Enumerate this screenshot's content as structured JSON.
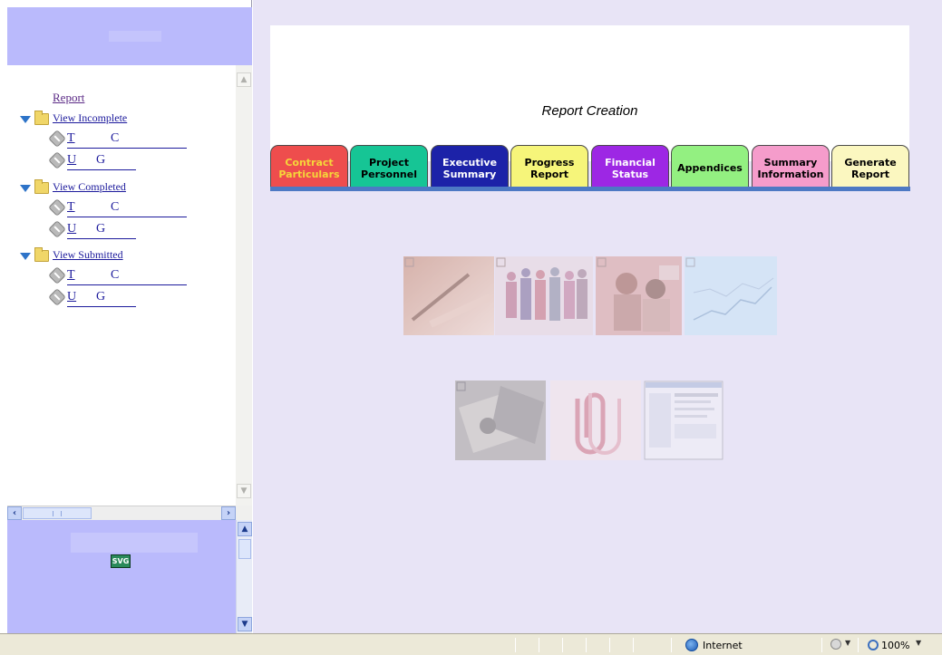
{
  "nav_tree": {
    "report_label": "Report",
    "groups": [
      {
        "label": "View Incomplete",
        "items": [
          {
            "first": "T",
            "second": "C"
          },
          {
            "first": "U",
            "second": "G"
          }
        ]
      },
      {
        "label": "View Completed",
        "items": [
          {
            "first": "T",
            "second": "C"
          },
          {
            "first": "U",
            "second": "G"
          }
        ]
      },
      {
        "label": "View Submitted",
        "items": [
          {
            "first": "T",
            "second": "C"
          },
          {
            "first": "U",
            "second": "G"
          }
        ]
      }
    ]
  },
  "bottom_panel": {
    "badge_text": "SVG"
  },
  "main": {
    "title": "Report Creation",
    "tabs": [
      {
        "label": "Contract\nParticulars",
        "bg": "#ee4d4d",
        "fg": "#f5d63a"
      },
      {
        "label": "Project\nPersonnel",
        "bg": "#16c595",
        "fg": "#000000"
      },
      {
        "label": "Executive\nSummary",
        "bg": "#1c22a8",
        "fg": "#ffffff"
      },
      {
        "label": "Progress\nReport",
        "bg": "#f6f57a",
        "fg": "#000000"
      },
      {
        "label": "Financial\nStatus",
        "bg": "#9d27e4",
        "fg": "#ffffff"
      },
      {
        "label": "Appendices",
        "bg": "#93f081",
        "fg": "#000000"
      },
      {
        "label": "Summary\nInformation",
        "bg": "#f59ccb",
        "fg": "#000000"
      },
      {
        "label": "Generate\nReport",
        "bg": "#fbf7c0",
        "fg": "#000000"
      }
    ],
    "tab_underline_color": "#4d79c4",
    "images": [
      {
        "name": "contract-image",
        "depicts": "pen on document"
      },
      {
        "name": "personnel-image",
        "depicts": "group of people"
      },
      {
        "name": "summary-image",
        "depicts": "people at computer"
      },
      {
        "name": "progress-image",
        "depicts": "chart lines"
      },
      {
        "name": "financial-image",
        "depicts": "money notes"
      },
      {
        "name": "appendices-image",
        "depicts": "paper clip"
      },
      {
        "name": "report-image",
        "depicts": "document screenshot"
      }
    ]
  },
  "status_bar": {
    "zone_text": "Internet",
    "zoom_text": "100%"
  },
  "colors": {
    "left_panel": "#babafc",
    "main_background": "#e8e4f6",
    "link": "#1c1a9c"
  }
}
